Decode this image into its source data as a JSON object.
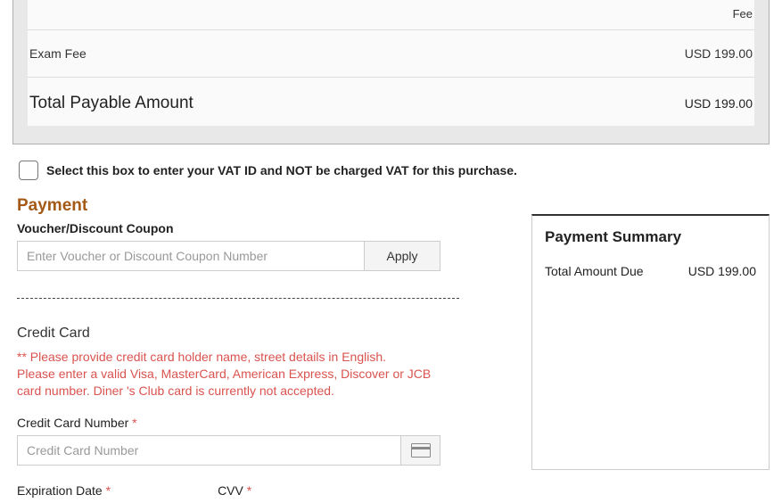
{
  "fee_panel": {
    "fee_header": "Fee",
    "item_label": "Exam Fee",
    "item_amount": "USD 199.00",
    "total_label": "Total Payable Amount",
    "total_amount": "USD 199.00"
  },
  "vat": {
    "label": "Select this box to enter your VAT ID and NOT be charged VAT for this purchase."
  },
  "payment": {
    "heading": "Payment",
    "voucher_label": "Voucher/Discount Coupon",
    "voucher_placeholder": "Enter Voucher or Discount Coupon Number",
    "apply_label": "Apply",
    "cc_heading": "Credit Card",
    "cc_warning_line1": "** Please provide credit card holder name, street details in English.",
    "cc_warning_line2": "Please enter a valid Visa, MasterCard, American Express, Discover or JCB card number. Diner 's Club card is currently not accepted.",
    "cc_number_label": "Credit Card Number",
    "cc_number_placeholder": "Credit Card Number",
    "expiration_label": "Expiration Date",
    "cvv_label": "CVV",
    "required_mark": "*"
  },
  "summary": {
    "title": "Payment Summary",
    "due_label": "Total Amount Due",
    "due_amount": "USD 199.00"
  }
}
